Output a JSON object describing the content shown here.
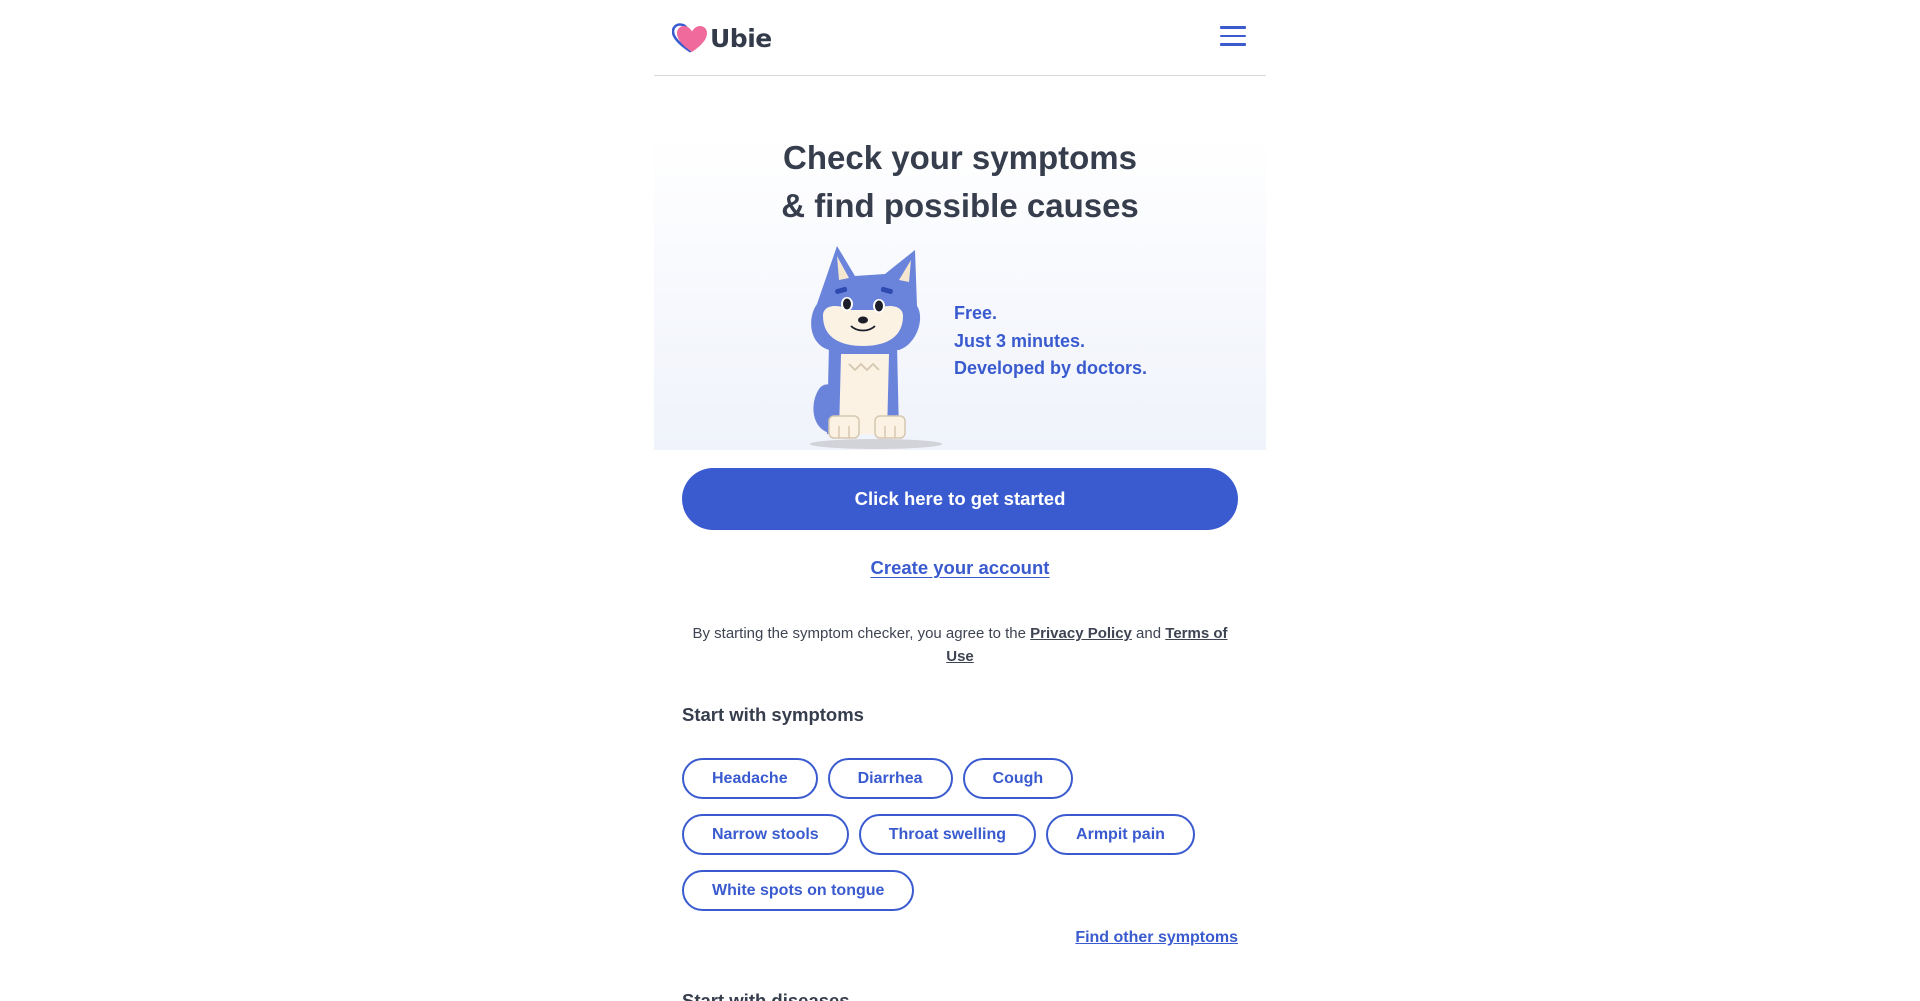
{
  "header": {
    "logo_text": "Ubie",
    "menu_icon": "hamburger-menu-icon"
  },
  "hero": {
    "title_line1": "Check your symptoms",
    "title_line2": "& find possible causes",
    "tagline1": "Free.",
    "tagline2": "Just 3 minutes.",
    "tagline3": "Developed by doctors.",
    "mascot": "wolf-mascot-illustration"
  },
  "cta": {
    "start_label": "Click here to get started",
    "create_account_label": "Create your account"
  },
  "agreement": {
    "prefix": "By starting the symptom checker, you agree to the ",
    "privacy_label": "Privacy Policy",
    "middle": " and ",
    "terms_label": "Terms of Use"
  },
  "symptoms": {
    "title": "Start with symptoms",
    "rows": [
      [
        "Headache",
        "Diarrhea",
        "Cough"
      ],
      [
        "Narrow stools",
        "Throat swelling",
        "Armpit pain"
      ],
      [
        "White spots on tongue"
      ]
    ],
    "find_other_label": "Find other symptoms"
  },
  "diseases": {
    "title": "Start with diseases"
  },
  "colors": {
    "accent": "#3a5bcf",
    "text": "#363d4d",
    "heart_pink": "#f06b9c"
  }
}
